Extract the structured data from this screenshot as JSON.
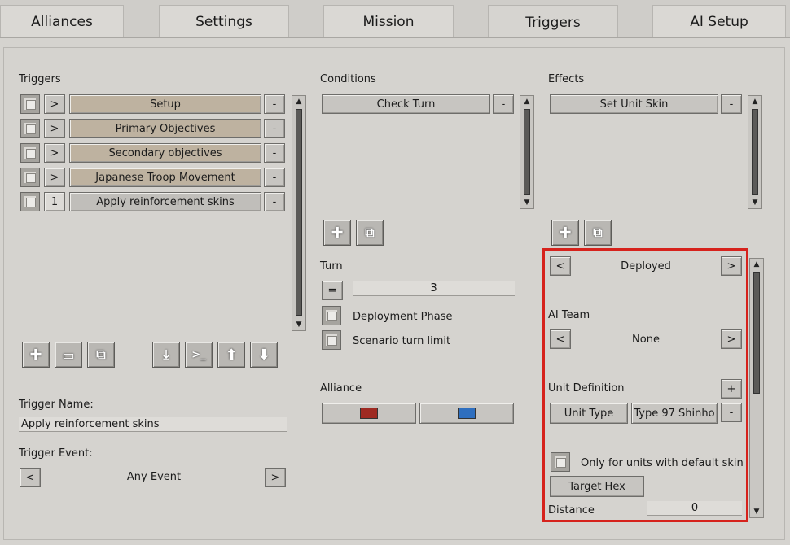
{
  "tabs": [
    "Alliances",
    "Settings",
    "Mission",
    "Triggers",
    "AI Setup"
  ],
  "triggers": {
    "heading": "Triggers",
    "items": [
      {
        "expander": ">",
        "label": "Setup"
      },
      {
        "expander": ">",
        "label": "Primary Objectives"
      },
      {
        "expander": ">",
        "label": "Secondary objectives"
      },
      {
        "expander": ">",
        "label": "Japanese Troop Movement"
      },
      {
        "expander": "1",
        "label": "Apply reinforcement skins"
      }
    ],
    "remove": "-"
  },
  "conditions": {
    "heading": "Conditions",
    "items": [
      "Check Turn"
    ]
  },
  "effects": {
    "heading": "Effects",
    "items": [
      "Set Unit Skin"
    ]
  },
  "turn": {
    "heading": "Turn",
    "operator": "=",
    "value": "3",
    "deployment_phase": "Deployment Phase",
    "scenario_turn_limit": "Scenario turn limit"
  },
  "alliance": {
    "heading": "Alliance",
    "colors": [
      "#9e2a22",
      "#2f6fbf"
    ]
  },
  "trigger_name": {
    "label": "Trigger Name:",
    "value": "Apply reinforcement skins"
  },
  "trigger_event": {
    "label": "Trigger Event:",
    "value": "Any Event"
  },
  "effect_detail": {
    "state": "Deployed",
    "ai_team_label": "AI Team",
    "ai_team": "None",
    "unit_def_label": "Unit Definition",
    "unit_type": "Unit Type",
    "unit_value": "Type 97 Shinho",
    "default_skin": "Only for units with default skin",
    "target_hex": "Target Hex",
    "distance_label": "Distance",
    "distance": "0"
  },
  "glyphs": {
    "prev": "<",
    "next": ">",
    "plus": "+",
    "minus": "-"
  },
  "highlight_color": "#d6221c"
}
